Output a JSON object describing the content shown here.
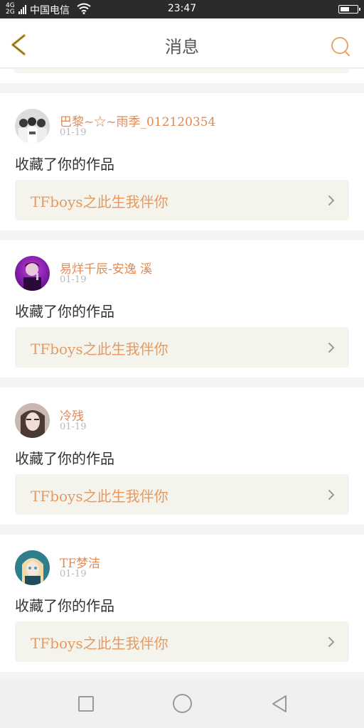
{
  "status_bar": {
    "signal_label": "4G 2G",
    "carrier": "中国电信",
    "time": "23:47",
    "icons": [
      "signal-icon",
      "wifi-icon",
      "battery-icon"
    ]
  },
  "header": {
    "title": "消息",
    "back_icon": "back-chevron-icon",
    "search_icon": "search-icon",
    "accent_color": "#e8a566",
    "back_color": "#d8b64a"
  },
  "messages": [
    {
      "username": "巴黎~☆~雨季_012120354",
      "date": "01-19",
      "action": "收藏了你的作品",
      "work_title": "TFboys之此生我伴你",
      "avatar_theme": "group-photo"
    },
    {
      "username": "易烊千辰-安逸 溪",
      "date": "01-19",
      "action": "收藏了你的作品",
      "work_title": "TFboys之此生我伴你",
      "avatar_theme": "purple-stage"
    },
    {
      "username": "冷残",
      "date": "01-19",
      "action": "收藏了你的作品",
      "work_title": "TFboys之此生我伴你",
      "avatar_theme": "girl-portrait"
    },
    {
      "username": "TF梦洁",
      "date": "01-19",
      "action": "收藏了你的作品",
      "work_title": "TFboys之此生我伴你",
      "avatar_theme": "anime-girl"
    }
  ],
  "colors": {
    "username": "#e08a55",
    "work_title": "#e39a63",
    "work_button_bg": "#f4f4ec"
  },
  "navbar": {
    "icons": [
      "recent-apps-icon",
      "home-icon",
      "back-icon"
    ]
  }
}
